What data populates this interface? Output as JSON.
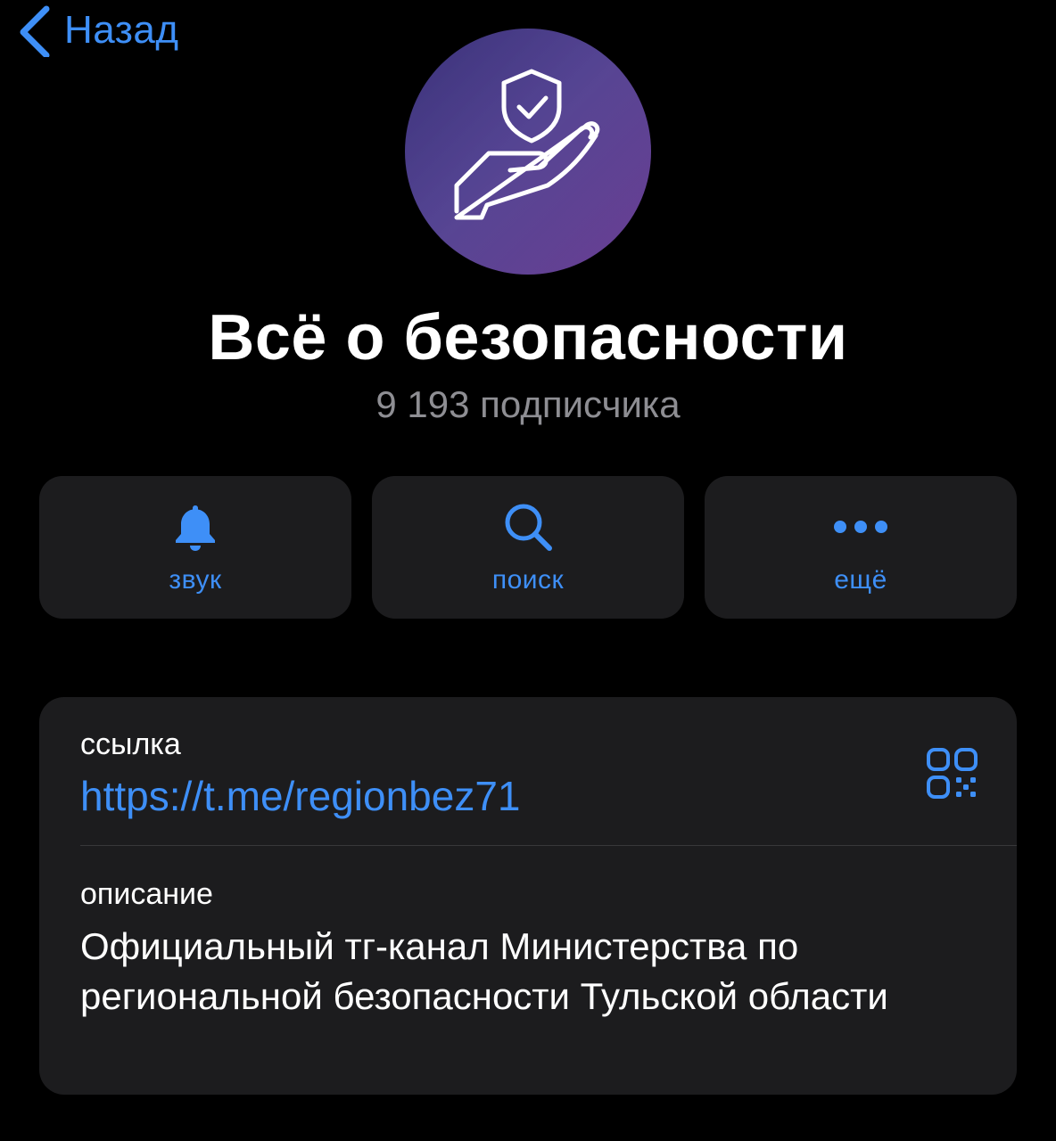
{
  "nav": {
    "back_label": "Назад"
  },
  "channel": {
    "avatar_icon": "hand-shield-check-icon",
    "title": "Всё о безопасности",
    "subscribers": "9 193 подписчика"
  },
  "actions": [
    {
      "label": "звук",
      "icon": "bell-icon"
    },
    {
      "label": "поиск",
      "icon": "search-icon"
    },
    {
      "label": "ещё",
      "icon": "more-dots-icon"
    }
  ],
  "info": {
    "link_label": "ссылка",
    "link_value": "https://t.me/regionbez71",
    "qr_icon": "qr-code-icon",
    "description_label": "описание",
    "description_value": "Официальный тг-канал Министерства по региональной безопасности Тульской области"
  },
  "colors": {
    "accent": "#3e8ff7",
    "background": "#000000",
    "card": "#1c1c1e",
    "secondary_text": "#8e8e93",
    "avatar_gradient": [
      "#3a3279",
      "#6a3e93"
    ]
  }
}
